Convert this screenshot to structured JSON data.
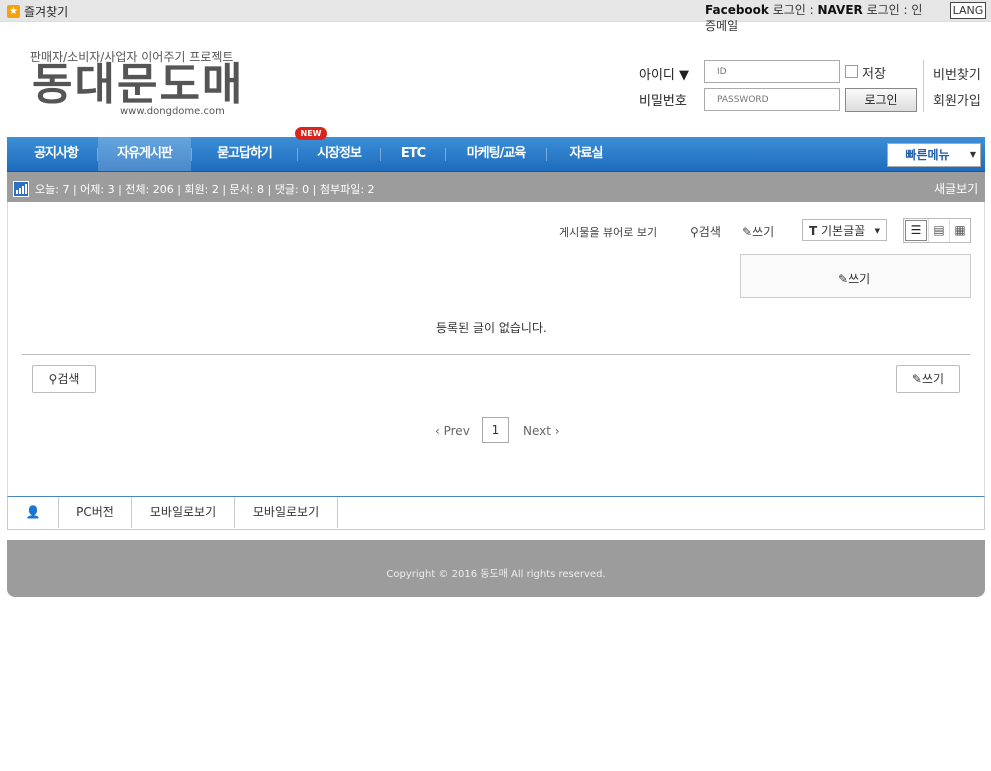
{
  "topbar": {
    "favorites": "즐겨찾기",
    "facebook": "Facebook",
    "facebook_login": " 로그인 : ",
    "naver": "NAVER",
    "naver_login": " 로그인 : ",
    "cert_login": "인증메일",
    "lang": "LANG"
  },
  "logo": {
    "subtitle": "판매자/소비자/사업자 이어주기 프로젝트",
    "name": "동대문도매",
    "url": "www.dongdome.com"
  },
  "login": {
    "id_label": "아이디 ▼",
    "pw_label": "비밀번호",
    "id_placeholder": "ID",
    "pw_placeholder": "PASSWORD",
    "save_label": "저장",
    "login_button": "로그인",
    "find_pw": "비번찾기",
    "join": "회원가입"
  },
  "nav": {
    "items": [
      "공지사항",
      "자유게시판",
      "묻고답하기",
      "시장정보",
      "ETC",
      "마케팅/교육",
      "자료실"
    ],
    "new_badge": "NEW",
    "quick_menu": "빠른메뉴"
  },
  "stats": {
    "text": "오늘: 7 | 어제: 3 | 전체: 206 | 회원: 2 | 문서: 8 | 댓글: 0 | 첨부파일: 2",
    "new_posts": "새글보기"
  },
  "board": {
    "viewer_label": "게시물을 뷰어로 보기",
    "search": "검색",
    "write": "쓰기",
    "font_select": "기본글꼴",
    "empty_message": "등록된 글이 없습니다.",
    "pagination": {
      "prev": "‹ Prev",
      "current": "1",
      "next": "Next ›"
    }
  },
  "footer": {
    "menu": [
      "PC버전",
      "모바일로보기",
      "모바일로보기"
    ],
    "copyright": "Copyright © 2016 동도매 All rights reserved."
  },
  "colors": {
    "nav_blue": "#1d6cbd",
    "gray_bar": "#9c9c9c"
  }
}
